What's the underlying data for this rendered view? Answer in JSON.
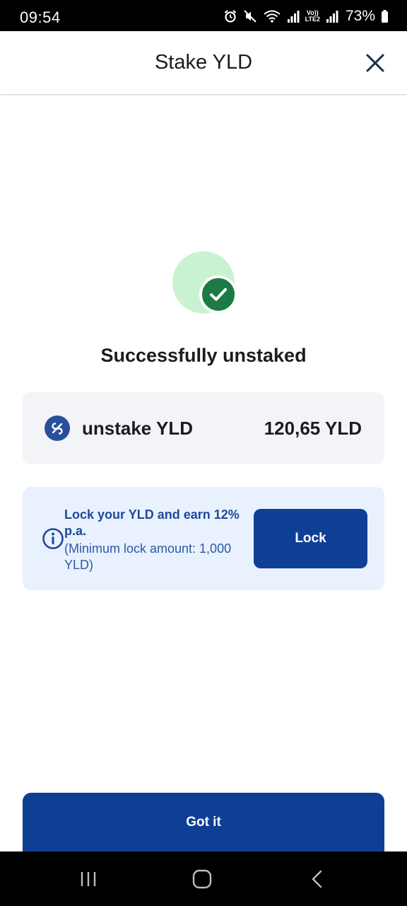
{
  "status_bar": {
    "time": "09:54",
    "battery": "73%",
    "icons": [
      "alarm-icon",
      "mute-icon",
      "wifi-icon",
      "signal-icon",
      "volte-icon",
      "signal-icon",
      "battery-icon"
    ],
    "volte_label_top": "Vo))",
    "volte_label_bottom": "LTE2"
  },
  "header": {
    "title": "Stake YLD",
    "close_icon": "close-icon"
  },
  "success": {
    "icon": "check-circle-icon",
    "title": "Successfully unstaked"
  },
  "summary": {
    "icon": "percent-icon",
    "label": "unstake YLD",
    "amount": "120,65 YLD"
  },
  "lock_offer": {
    "icon": "info-icon",
    "title": "Lock your YLD and earn 12% p.a.",
    "subtitle": "(Minimum lock amount: 1,000 YLD)",
    "button_label": "Lock"
  },
  "footer": {
    "button_label": "Got it"
  },
  "nav_bar": {
    "buttons": [
      "recent-apps-icon",
      "home-icon",
      "back-icon"
    ]
  },
  "colors": {
    "primary": "#0f3f95",
    "success_green": "#1b7a45",
    "success_bg": "#c9f2d1",
    "info_text": "#1e4a9c",
    "card_bg": "#f3f4f8",
    "lock_card_bg": "#e8f1fd"
  }
}
